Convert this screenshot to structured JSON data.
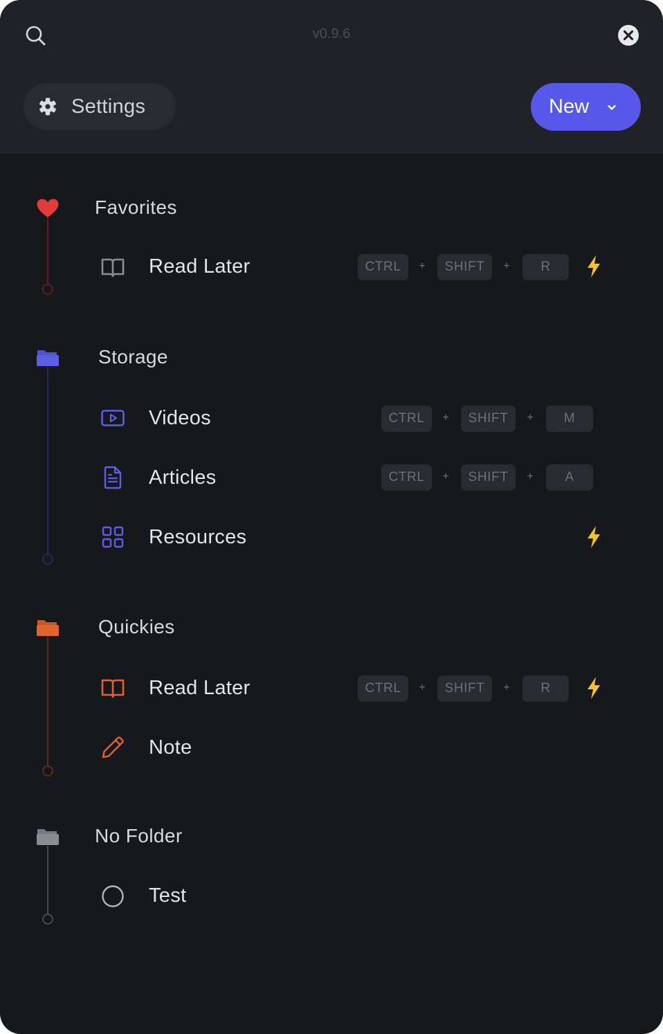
{
  "app": {
    "version": "v0.9.6"
  },
  "header": {
    "settings_label": "Settings",
    "new_label": "New"
  },
  "icons": {
    "search": "search-icon",
    "close": "close-icon",
    "settings": "gear-icon",
    "new": "chevron-down-icon",
    "favorites": "heart-icon",
    "storage": "folder-icon",
    "quickies": "folder-icon",
    "no_folder": "folder-icon",
    "read_later": "book-open-icon",
    "videos": "play-icon",
    "articles": "document-icon",
    "resources": "grid-icon",
    "note": "pencil-icon",
    "test": "circle-icon",
    "quick_action": "lightning-icon"
  },
  "colors": {
    "favorites": "#e23b3b",
    "storage": "#5a5fe6",
    "quickies": "#e0652c",
    "no_folder": "#8b8c92",
    "accent": "#5558e8",
    "bolt": "#f2c12e"
  },
  "sections": [
    {
      "title": "Favorites",
      "items": [
        {
          "label": "Read Later",
          "keys": [
            "CTRL",
            "SHIFT",
            "R"
          ],
          "plus": "+"
        }
      ]
    },
    {
      "title": "Storage",
      "items": [
        {
          "label": "Videos",
          "keys": [
            "CTRL",
            "SHIFT",
            "M"
          ],
          "plus": "+"
        },
        {
          "label": "Articles",
          "keys": [
            "CTRL",
            "SHIFT",
            "A"
          ],
          "plus": "+"
        },
        {
          "label": "Resources"
        }
      ]
    },
    {
      "title": "Quickies",
      "items": [
        {
          "label": "Read Later",
          "keys": [
            "CTRL",
            "SHIFT",
            "R"
          ],
          "plus": "+"
        },
        {
          "label": "Note"
        }
      ]
    },
    {
      "title": "No Folder",
      "items": [
        {
          "label": "Test"
        }
      ]
    }
  ]
}
